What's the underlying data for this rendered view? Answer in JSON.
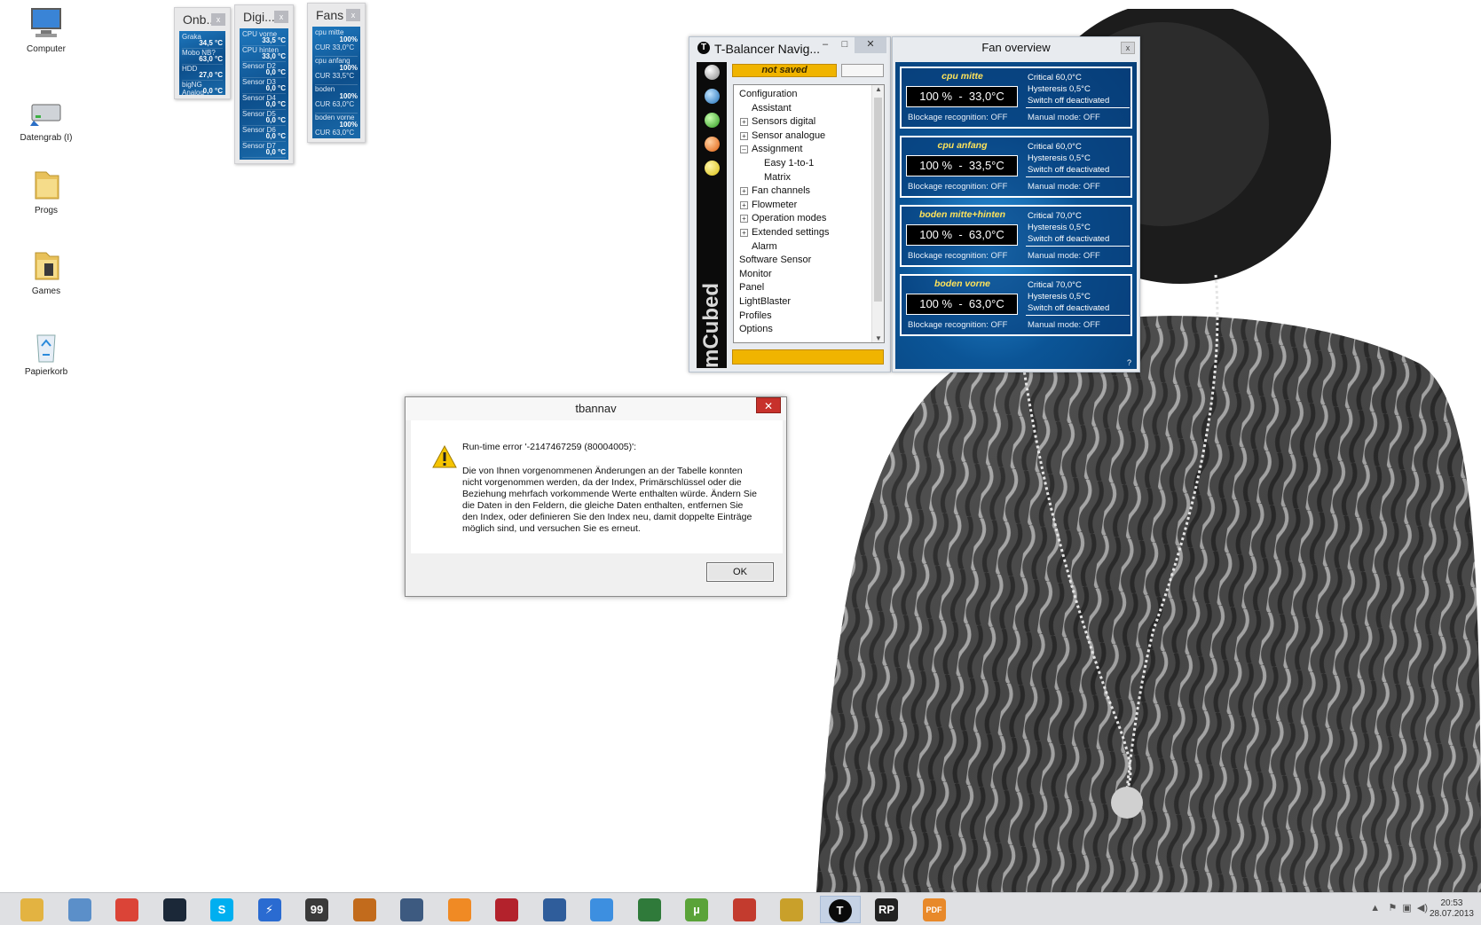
{
  "desktop": {
    "icons": [
      {
        "label": "Computer",
        "icon": "computer-icon"
      },
      {
        "label": "Datengrab (I)",
        "icon": "drive-icon"
      },
      {
        "label": "Progs",
        "icon": "folder-icon"
      },
      {
        "label": "Games",
        "icon": "folder-icon"
      },
      {
        "label": "Papierkorb",
        "icon": "recycle-bin-icon"
      }
    ]
  },
  "gadgets": {
    "onboard": {
      "title": "Onb...",
      "close": "x",
      "rows": [
        {
          "label": "Graka",
          "value": "34,5 °C"
        },
        {
          "label": "Mobo NB?",
          "value": "63,0 °C"
        },
        {
          "label": "HDD",
          "value": "27,0 °C"
        },
        {
          "label": "bigNG Analog",
          "value": "0,0 °C"
        }
      ]
    },
    "digital": {
      "title": "Digi...",
      "close": "x",
      "rows": [
        {
          "label": "CPU vorne",
          "value": "33,5 °C"
        },
        {
          "label": "CPU hinten",
          "value": "33,0 °C"
        },
        {
          "label": "Sensor D2",
          "value": "0,0 °C"
        },
        {
          "label": "Sensor D3",
          "value": "0,0 °C"
        },
        {
          "label": "Sensor D4",
          "value": "0,0 °C"
        },
        {
          "label": "Sensor D5",
          "value": "0,0 °C"
        },
        {
          "label": "Sensor D6",
          "value": "0,0 °C"
        },
        {
          "label": "Sensor D7",
          "value": "0,0 °C"
        }
      ]
    },
    "fans": {
      "title": "Fans",
      "close": "x",
      "rows": [
        {
          "label": "cpu mitte",
          "value": "100%",
          "cur": "CUR  33,0°C"
        },
        {
          "label": "cpu anfang",
          "value": "100%",
          "cur": "CUR  33,5°C"
        },
        {
          "label": "boden",
          "value": "100%",
          "cur": "CUR  63,0°C"
        },
        {
          "label": "boden vorne",
          "value": "100%",
          "cur": "CUR  63,0°C"
        }
      ]
    }
  },
  "navigator": {
    "title": "T-Balancer Navig...",
    "title_icon": "T",
    "minimize": "–",
    "maximize": "□",
    "close": "✕",
    "status": "not saved",
    "brand": "mCubed",
    "tree": [
      {
        "label": "Configuration",
        "level": 0,
        "expander": ""
      },
      {
        "label": "Assistant",
        "level": 1,
        "expander": ""
      },
      {
        "label": "Sensors digital",
        "level": 1,
        "expander": "+"
      },
      {
        "label": "Sensor analogue",
        "level": 1,
        "expander": "+"
      },
      {
        "label": "Assignment",
        "level": 1,
        "expander": "–"
      },
      {
        "label": "Easy 1-to-1",
        "level": 2,
        "expander": ""
      },
      {
        "label": "Matrix",
        "level": 2,
        "expander": ""
      },
      {
        "label": "Fan channels",
        "level": 1,
        "expander": "+"
      },
      {
        "label": "Flowmeter",
        "level": 1,
        "expander": "+"
      },
      {
        "label": "Operation modes",
        "level": 1,
        "expander": "+"
      },
      {
        "label": "Extended settings",
        "level": 1,
        "expander": "+"
      },
      {
        "label": "Alarm",
        "level": 1,
        "expander": ""
      },
      {
        "label": "Software Sensor",
        "level": 0,
        "expander": ""
      },
      {
        "label": "Monitor",
        "level": 0,
        "expander": ""
      },
      {
        "label": "Panel",
        "level": 0,
        "expander": ""
      },
      {
        "label": "LightBlaster",
        "level": 0,
        "expander": ""
      },
      {
        "label": "Profiles",
        "level": 0,
        "expander": ""
      },
      {
        "label": "Options",
        "level": 0,
        "expander": ""
      }
    ]
  },
  "fan_overview": {
    "title": "Fan overview",
    "close": "x",
    "help": "?",
    "fans": [
      {
        "name": "cpu mitte",
        "speed": "100 %",
        "temp": "33,0°C",
        "critical": "Critical 60,0°C",
        "hysteresis": "Hysteresis 0,5°C",
        "switch_off": "Switch off deactivated",
        "blockage": "Blockage recognition: OFF",
        "manual": "Manual mode: OFF"
      },
      {
        "name": "cpu anfang",
        "speed": "100 %",
        "temp": "33,5°C",
        "critical": "Critical 60,0°C",
        "hysteresis": "Hysteresis 0,5°C",
        "switch_off": "Switch off deactivated",
        "blockage": "Blockage recognition: OFF",
        "manual": "Manual mode: OFF"
      },
      {
        "name": "boden mitte+hinten",
        "speed": "100 %",
        "temp": "63,0°C",
        "critical": "Critical 70,0°C",
        "hysteresis": "Hysteresis 0,5°C",
        "switch_off": "Switch off deactivated",
        "blockage": "Blockage recognition: OFF",
        "manual": "Manual mode: OFF"
      },
      {
        "name": "boden vorne",
        "speed": "100 %",
        "temp": "63,0°C",
        "critical": "Critical 70,0°C",
        "hysteresis": "Hysteresis 0,5°C",
        "switch_off": "Switch off deactivated",
        "blockage": "Blockage recognition: OFF",
        "manual": "Manual mode: OFF"
      }
    ]
  },
  "dialog": {
    "title": "tbannav",
    "close": "✕",
    "heading": "Run-time error '-2147467259 (80004005)':",
    "message": "Die von Ihnen vorgenommenen Änderungen an der Tabelle konnten nicht vorgenommen werden, da der Index, Primärschlüssel oder die Beziehung mehrfach vorkommende Werte enthalten würde. Ändern Sie die Daten in den Feldern, die gleiche Daten enthalten, entfernen Sie den Index, oder definieren Sie den Index neu, damit doppelte Einträge möglich sind, und versuchen Sie es erneut.",
    "ok_label": "OK"
  },
  "taskbar": {
    "apps": [
      {
        "icon": "file-explorer-icon",
        "color": "#e3b341",
        "glyph": ""
      },
      {
        "icon": "control-panel-icon",
        "color": "#5b8fc9",
        "glyph": ""
      },
      {
        "icon": "chrome-icon",
        "color": "#db4437",
        "glyph": ""
      },
      {
        "icon": "steam-icon",
        "color": "#1b2838",
        "glyph": ""
      },
      {
        "icon": "skype-icon",
        "color": "#00aff0",
        "glyph": "S"
      },
      {
        "icon": "thunder-icon",
        "color": "#2a6bd1",
        "glyph": "⚡"
      },
      {
        "icon": "monitor-app-icon",
        "color": "#3a3a3a",
        "glyph": "99"
      },
      {
        "icon": "fire-app-icon",
        "color": "#c26b1c",
        "glyph": ""
      },
      {
        "icon": "teamspeak-icon",
        "color": "#3d5a80",
        "glyph": ""
      },
      {
        "icon": "vlc-like-icon",
        "color": "#f08a24",
        "glyph": ""
      },
      {
        "icon": "striped-app-icon",
        "color": "#b3222c",
        "glyph": ""
      },
      {
        "icon": "thunderbird-icon",
        "color": "#2f5d9b",
        "glyph": ""
      },
      {
        "icon": "dropbox-icon",
        "color": "#3d8fe0",
        "glyph": ""
      },
      {
        "icon": "excel-like-icon",
        "color": "#2f7a3a",
        "glyph": ""
      },
      {
        "icon": "utorrent-icon",
        "color": "#5aa339",
        "glyph": "µ"
      },
      {
        "icon": "ccleaner-icon",
        "color": "#c33b2e",
        "glyph": ""
      },
      {
        "icon": "globe-app-icon",
        "color": "#c9a02a",
        "glyph": ""
      },
      {
        "icon": "tbalancer-icon",
        "color": "#0a0a0a",
        "glyph": "T"
      },
      {
        "icon": "rp-icon",
        "color": "#222222",
        "glyph": "RP"
      },
      {
        "icon": "pdf-icon",
        "color": "#e8892a",
        "glyph": "PDF"
      }
    ],
    "time": "20:53",
    "date": "28.07.2013"
  }
}
